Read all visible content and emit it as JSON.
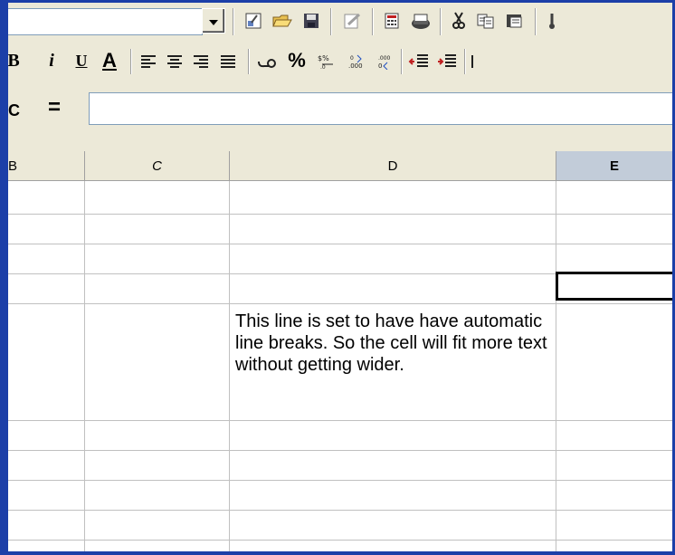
{
  "toolbar_standard": {
    "font_name_value": "",
    "icons": [
      "edit-file-icon",
      "open-folder-icon",
      "save-disk-icon",
      "edit-document-icon",
      "calculator-icon",
      "print-icon",
      "cut-scissors-icon",
      "copy-icon",
      "paste-icon"
    ]
  },
  "toolbar_format": {
    "bold_label": "B",
    "italic_label": "i",
    "underline_label": "U",
    "font_color_label": "A",
    "currency_label": "$%",
    "percent_label": "%",
    "icons": [
      "align-left-icon",
      "align-center-icon",
      "align-right-icon",
      "justify-icon",
      "number-format-currency-icon",
      "percent-icon",
      "standard-format-icon",
      "add-decimal-icon",
      "delete-decimal-icon",
      "increase-indent-icon",
      "decrease-indent-icon"
    ]
  },
  "formula_bar": {
    "cell_ref": "C",
    "equals_sign": "=",
    "formula_value": ""
  },
  "columns": [
    {
      "label": "B",
      "selected": false
    },
    {
      "label": "C",
      "selected": false
    },
    {
      "label": "D",
      "selected": false
    },
    {
      "label": "E",
      "selected": true
    }
  ],
  "cells": {
    "D_wrapped": "This line is set to have have automatic line breaks. So the cell will fit more text without getting wider."
  },
  "colors": {
    "frame": "#1c3fa8",
    "chrome": "#ece9d8",
    "selected_header": "#c2ccd9",
    "grid": "#c0c0c0"
  }
}
